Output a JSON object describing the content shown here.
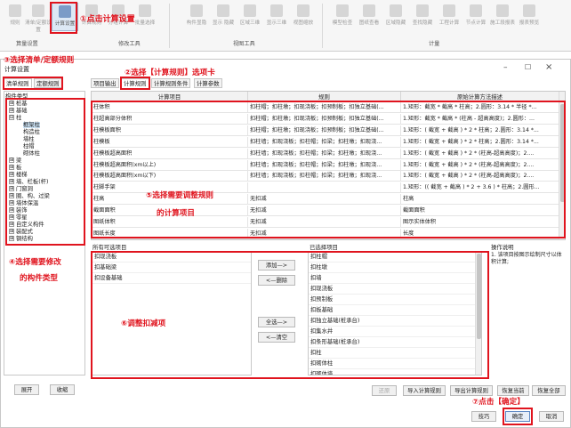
{
  "ribbon": {
    "buttons": [
      "规则",
      "清单/定额设置",
      "计算设置",
      "计算规则",
      "分组计算",
      "批量选择",
      "构件显隐",
      "显示 隐藏",
      "区域三维",
      "显示三维",
      "视图缩放",
      "模型检查",
      "图纸查看",
      "区域隐藏",
      "查找隐藏",
      "工程计算",
      "节点计算",
      "施工段报表",
      "报表预览"
    ],
    "groups": [
      "算量设置",
      "修改工具",
      "视图工具",
      "计量"
    ]
  },
  "dialog": {
    "title": "计算设置",
    "controls": {
      "minimize": "–",
      "maximize": "☐",
      "close": "×"
    }
  },
  "tabs_top": [
    "清单规则",
    "定额规则"
  ],
  "tabs_main": [
    "项目输出",
    "计算规则",
    "计算规则条件",
    "计算参数"
  ],
  "tree": {
    "header": "构件类型",
    "items": [
      {
        "label": "桩基",
        "toggle": "⊞"
      },
      {
        "label": "基础",
        "toggle": "⊞"
      },
      {
        "label": "柱",
        "toggle": "⊟"
      },
      {
        "label": "框架柱",
        "toggle": "",
        "selected": true
      },
      {
        "label": "构造柱",
        "toggle": ""
      },
      {
        "label": "墙柱",
        "toggle": ""
      },
      {
        "label": "柱帽",
        "toggle": ""
      },
      {
        "label": "砌体柱",
        "toggle": ""
      },
      {
        "label": "梁",
        "toggle": "⊞"
      },
      {
        "label": "板",
        "toggle": "⊞"
      },
      {
        "label": "楼梯",
        "toggle": "⊞"
      },
      {
        "label": "墙、栏板(杆)",
        "toggle": "⊞"
      },
      {
        "label": "门窗洞",
        "toggle": "⊞"
      },
      {
        "label": "圈、构、过梁",
        "toggle": "⊞"
      },
      {
        "label": "墙体保温",
        "toggle": "⊞"
      },
      {
        "label": "装饰",
        "toggle": "⊞"
      },
      {
        "label": "零星",
        "toggle": "⊞"
      },
      {
        "label": "自定义构件",
        "toggle": "⊞"
      },
      {
        "label": "装配式",
        "toggle": "⊞"
      },
      {
        "label": "钢结构",
        "toggle": "⊞"
      }
    ],
    "expand_button": "展开",
    "collapse_button": "收缩"
  },
  "table": {
    "headers": [
      "计算项目",
      "规则",
      "原始计算方法描述"
    ],
    "rows": [
      [
        "柱体积",
        "扣柱帽；扣柱墩；扣现浇板；扣预制板；扣独立基础(...",
        "1.矩形：截宽 * 截高 * 柱高；2.圆形：3.14 * 半径 *..."
      ],
      [
        "柱超高部分体积",
        "扣柱帽；扣柱墩；扣现浇板；扣预制板；扣独立基础(...",
        "1.矩形：截宽 * 截高 * (柱高 - 超高高度)；2.圆形：..."
      ],
      [
        "柱模板面积",
        "扣柱帽；扣柱墩；扣现浇板；扣预制板；扣独立基础(...",
        "1.矩形：( 截宽 + 截高 ) * 2 * 柱高；2.圆形：3.14 *..."
      ],
      [
        "柱模板",
        "扣柱墙；扣现浇板；扣柱帽；扣梁；扣柱墩；扣现浇...",
        "1.矩形：( 截宽 + 截高 ) * 2 * 柱高；2.圆形：3.14 *..."
      ],
      [
        "柱模板超高面积",
        "扣柱墙；扣现浇板；扣柱帽；扣梁；扣柱墩；扣现浇...",
        "1.矩形：( 截宽 + 截高 ) * 2 * (柱高-超高高度)；2...."
      ],
      [
        "柱模板超高面积(xm以上)",
        "扣柱墙；扣现浇板；扣柱帽；扣梁；扣柱墩；扣现浇...",
        "1.矩形：( 截宽 + 截高 ) * 2 * (柱高-超高高度)；2...."
      ],
      [
        "柱模板超高面积(xm以下)",
        "扣柱墙；扣现浇板；扣柱帽；扣梁；扣柱墩；扣现浇...",
        "1.矩形：( 截宽 + 截高 ) * 2 * (柱高-超高高度)；2...."
      ],
      [
        "柱脚手架",
        "",
        "1.矩形：(( 截宽 + 截高 ) * 2 + 3.6 ) * 柱高；2.圆形..."
      ],
      [
        "柱高",
        "无扣减",
        "柱高"
      ],
      [
        "截面面积",
        "无扣减",
        "截面面积"
      ],
      [
        "图纸体积",
        "无扣减",
        "图示实体体积"
      ],
      [
        "图纸长度",
        "无扣减",
        "长度"
      ]
    ]
  },
  "lists": {
    "available_header": "所有可选项目",
    "available": [
      "扣现浇板",
      "扣基础梁",
      "扣设备基础"
    ],
    "selected_header": "已选择项目",
    "selected": [
      "扣柱帽",
      "扣柱墩",
      "扣墙",
      "扣现浇板",
      "扣预制板",
      "扣板基础",
      "扣独立基础(桩承台)",
      "扣集水井",
      "扣条形基础(桩承台)",
      "扣柱",
      "扣砌体柱",
      "扣砌体墙",
      "扣砌体梁"
    ],
    "add_button": "添加—>",
    "remove_button": "<—删除",
    "add_all_button": "全选—>",
    "clear_button": "<—清空"
  },
  "instructions": {
    "title": "操作说明",
    "text": "1. 该项目按图示绘制尺寸以体积计算;"
  },
  "bottom_buttons": {
    "restore": "还原",
    "import_rules": "导入计算规则",
    "export_rules": "导出计算规则",
    "restore_current": "恢复当前",
    "restore_all": "恢复全部",
    "tips": "技巧",
    "ok": "确定",
    "cancel": "取消"
  },
  "annotations": {
    "a1": "①点击计算设置",
    "a2": "②选择【计算规则】选项卡",
    "a3": "③选择清单/定额规则",
    "a4_line1": "④选择需要修改",
    "a4_line2": "的构件类型",
    "a5_line1": "⑤选择需要调整规则",
    "a5_line2": "的计算项目",
    "a6": "⑥调整扣减项",
    "a7": "⑦点击【确定】"
  },
  "colors": {
    "annotation": "#e0141e",
    "selection": "#cde4f7",
    "ribbon_active": "#dde8f5"
  }
}
